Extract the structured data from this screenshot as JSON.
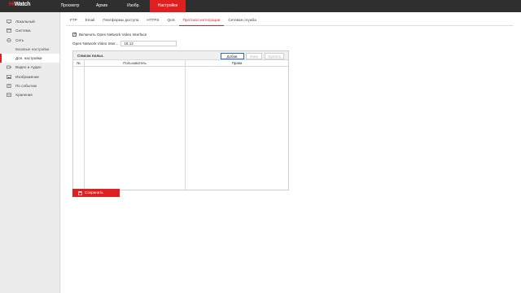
{
  "brand": {
    "prefix": "Hi",
    "suffix": "Watch"
  },
  "topnav": [
    {
      "label": "Просмотр",
      "active": false
    },
    {
      "label": "Архив",
      "active": false
    },
    {
      "label": "Изобр.",
      "active": false
    },
    {
      "label": "Настройки",
      "active": true
    }
  ],
  "sidebar": {
    "items": [
      {
        "label": "Локальный",
        "icon": "monitor-icon",
        "sub": false,
        "active": false
      },
      {
        "label": "Система",
        "icon": "system-icon",
        "sub": false,
        "active": false
      },
      {
        "label": "Сеть",
        "icon": "globe-icon",
        "sub": false,
        "active": false
      },
      {
        "label": "Базовые настройки",
        "icon": "",
        "sub": true,
        "active": false
      },
      {
        "label": "Доп. настройки",
        "icon": "",
        "sub": true,
        "active": true
      },
      {
        "label": "Видео и Аудио",
        "icon": "video-icon",
        "sub": false,
        "active": false
      },
      {
        "label": "Изображение",
        "icon": "image-icon",
        "sub": false,
        "active": false
      },
      {
        "label": "По событию",
        "icon": "event-icon",
        "sub": false,
        "active": false
      },
      {
        "label": "Хранение",
        "icon": "storage-icon",
        "sub": false,
        "active": false
      }
    ]
  },
  "tabs": [
    {
      "label": "FTP",
      "active": false
    },
    {
      "label": "Email",
      "active": false
    },
    {
      "label": "Платформы доступа",
      "active": false
    },
    {
      "label": "HTTPS",
      "active": false
    },
    {
      "label": "QoS",
      "active": false
    },
    {
      "label": "Протокол интеграции",
      "active": true
    },
    {
      "label": "Сетевая служба",
      "active": false
    }
  ],
  "onvif": {
    "enable_label": "Включить Open Network Video Interface",
    "enabled": true,
    "version_label": "Open Network Video Inter...",
    "version_value": "18.12"
  },
  "users": {
    "title": "Список польз.",
    "add_label": "Добав.",
    "modify_label": "Изме",
    "delete_label": "Удалить",
    "columns": [
      "№",
      "Пользователь",
      "Права"
    ],
    "rows": []
  },
  "save_label": "Сохранить",
  "colors": {
    "accent": "#e02020",
    "topbar": "#2f2f2f",
    "focus": "#2d6bd8"
  }
}
